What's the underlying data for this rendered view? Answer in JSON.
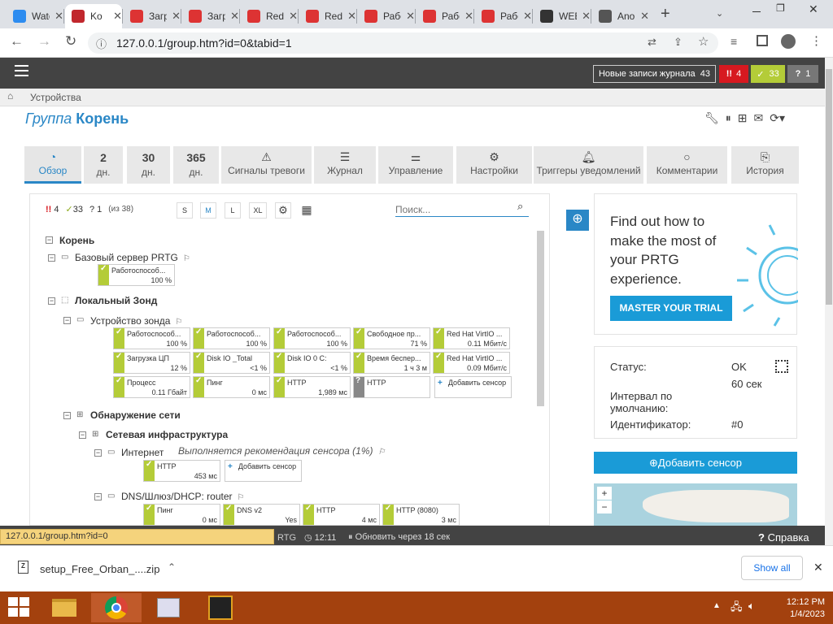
{
  "browser": {
    "tabs": [
      {
        "label": "Watch",
        "icon": "play-icon",
        "color": "#2d8cf0",
        "active": false
      },
      {
        "label": "Ko",
        "icon": "prtg-icon",
        "color": "#c1272d",
        "active": true
      },
      {
        "label": "Загру",
        "icon": "redhat-icon",
        "color": "#d33",
        "active": false
      },
      {
        "label": "Загру",
        "icon": "redhat-icon",
        "color": "#d33",
        "active": false
      },
      {
        "label": "Red H",
        "icon": "redhat-icon",
        "color": "#d33",
        "active": false
      },
      {
        "label": "Red H",
        "icon": "redhat-icon",
        "color": "#d33",
        "active": false
      },
      {
        "label": "Рабо",
        "icon": "redhat-icon",
        "color": "#d33",
        "active": false
      },
      {
        "label": "Рабо",
        "icon": "redhat-icon",
        "color": "#d33",
        "active": false
      },
      {
        "label": "Рабо",
        "icon": "redhat-icon",
        "color": "#d33",
        "active": false
      },
      {
        "label": "WEB",
        "icon": "eye-icon",
        "color": "#333",
        "active": false
      },
      {
        "label": "Anony",
        "icon": "anon-icon",
        "color": "#555",
        "active": false
      }
    ],
    "url": "127.0.0.1/group.htm?id=0&tabid=1"
  },
  "header": {
    "log_label": "Новые записи журнала",
    "log_count": "43",
    "alarm_count": "4",
    "ok_count": "33",
    "unknown_count": "1"
  },
  "breadcrumb": "Устройства",
  "page": {
    "title_prefix": "Группа",
    "title": "Корень"
  },
  "tabs": [
    {
      "label": "Обзор",
      "kind": "icon",
      "icon": "gauge-icon"
    },
    {
      "big": "2",
      "label": "дн.",
      "kind": "big"
    },
    {
      "big": "30",
      "label": "дн.",
      "kind": "big"
    },
    {
      "big": "365",
      "label": "дн.",
      "kind": "big"
    },
    {
      "label": "Сигналы тревоги",
      "kind": "icon",
      "icon": "warning-icon"
    },
    {
      "label": "Журнал",
      "kind": "icon",
      "icon": "log-icon"
    },
    {
      "label": "Управление",
      "kind": "icon",
      "icon": "sliders-icon"
    },
    {
      "label": "Настройки",
      "kind": "icon",
      "icon": "gear-icon"
    },
    {
      "label": "Триггеры уведомлений",
      "kind": "icon",
      "icon": "bell-icon"
    },
    {
      "label": "Комментарии",
      "kind": "icon",
      "icon": "comment-icon"
    },
    {
      "label": "История",
      "kind": "icon",
      "icon": "history-icon"
    }
  ],
  "toolbar": {
    "alarm": "4",
    "ok": "33",
    "unknown": "1",
    "total": "(из 38)",
    "sizes": [
      "S",
      "M",
      "L",
      "XL"
    ],
    "search_placeholder": "Поиск..."
  },
  "tree": {
    "root": "Корень",
    "probe_server": "Базовый сервер PRTG",
    "probe_server_sensor": {
      "name": "Работоспособ...",
      "value": "100 %"
    },
    "local_probe": "Локальный Зонд",
    "probe_device": "Устройство зонда",
    "probe_sensors": [
      {
        "name": "Работоспособ...",
        "value": "100 %",
        "status": "ok"
      },
      {
        "name": "Работоспособ...",
        "value": "100 %",
        "status": "ok"
      },
      {
        "name": "Работоспособ...",
        "value": "100 %",
        "status": "ok"
      },
      {
        "name": "Свободное пр...",
        "value": "71 %",
        "status": "ok"
      },
      {
        "name": "Red Hat VirtIO ...",
        "value": "0.11 Мбит/с",
        "status": "ok"
      },
      {
        "name": "Загрузка ЦП",
        "value": "12 %",
        "status": "ok"
      },
      {
        "name": "Disk IO _Total",
        "value": "<1 %",
        "status": "ok"
      },
      {
        "name": "Disk IO 0 C:",
        "value": "<1 %",
        "status": "ok"
      },
      {
        "name": "Время беспер...",
        "value": "1 ч 3 м",
        "status": "ok"
      },
      {
        "name": "Red Hat VirtIO ...",
        "value": "0.09 Мбит/с",
        "status": "ok"
      },
      {
        "name": "Процесс",
        "value": "0.11 Гбайт",
        "status": "ok"
      },
      {
        "name": "Пинг",
        "value": "0 мс",
        "status": "ok"
      },
      {
        "name": "HTTP",
        "value": "1,989 мс",
        "status": "ok"
      },
      {
        "name": "HTTP",
        "value": "",
        "status": "unknown"
      }
    ],
    "add_sensor": "Добавить сенсор",
    "network_discovery": "Обнаружение сети",
    "network_infra": "Сетевая инфраструктура",
    "internet": "Интернет",
    "internet_note": "Выполняется рекомендация сенсора (1%)",
    "internet_sensors": [
      {
        "name": "HTTP",
        "value": "453 мс",
        "status": "ok"
      }
    ],
    "dns": "DNS/Шлюз/DHCP: router",
    "dns_sensors": [
      {
        "name": "Пинг",
        "value": "0 мс",
        "status": "ok"
      },
      {
        "name": "DNS v2",
        "value": "Yes",
        "status": "ok"
      },
      {
        "name": "HTTP",
        "value": "4 мс",
        "status": "ok"
      },
      {
        "name": "HTTP (8080)",
        "value": "3 мс",
        "status": "ok"
      }
    ]
  },
  "promo": {
    "text": "Find out how to make the most of your PRTG experience.",
    "button": "MASTER YOUR TRIAL"
  },
  "status_panel": {
    "status_label": "Статус:",
    "status_value": "OK",
    "interval_label": "Интервал по умолчанию:",
    "interval_value": "60 сек",
    "id_label": "Идентификатор:",
    "id_value": "#0"
  },
  "add_sensor_button": "Добавить сенсор",
  "statusbar": {
    "link": "127.0.0.1/group.htm?id=0",
    "prtg": "RTG",
    "time": "12:11",
    "refresh": "Обновить через 18 сек",
    "help": "Справка"
  },
  "download": {
    "file": "setup_Free_Orban_....zip",
    "show_all": "Show all"
  },
  "taskbar": {
    "time": "12:12 PM",
    "date": "1/4/2023"
  }
}
